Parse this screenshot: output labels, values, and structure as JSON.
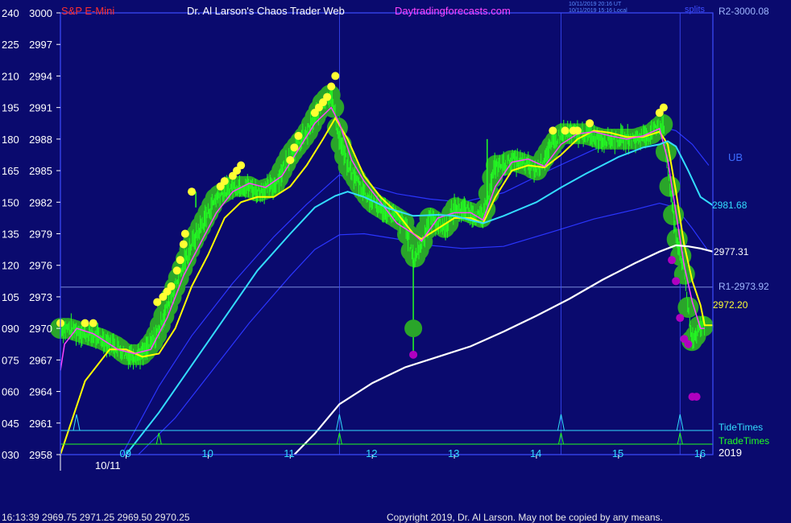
{
  "header": {
    "symbol": "S&P E-Mini",
    "title": "Dr. Al Larson's Chaos Trader Web",
    "site": "Daytradingforecasts.com",
    "ts_utc": "10/11/2019 20:16 UT",
    "ts_local": "10/11/2019 15:16 Local",
    "corner_label": "splits"
  },
  "colors": {
    "background": "#0a0a6e",
    "price_bars": "#22ff22",
    "halo": "#2aa52a",
    "yellow_line": "#ffff00",
    "magenta_line": "#ff44ff",
    "cyan_line": "#33ddff",
    "blue_band": "#2a35ff",
    "white_line": "#ffffff",
    "tide": "#33ddff",
    "trade": "#22ff22",
    "symbol": "#ff3030",
    "site": "#ff44ff"
  },
  "chart_data": {
    "type": "line",
    "x_ticks": [
      "09",
      "10",
      "11",
      "12",
      "13",
      "14",
      "15",
      "16"
    ],
    "x_tick_values": [
      9,
      10,
      11,
      12,
      13,
      14,
      15,
      16
    ],
    "date_label": "10/11",
    "year_label": "2019",
    "xlim": [
      8.2,
      16.15
    ],
    "y_ticks_price": [
      "3000",
      "2997",
      "2994",
      "2991",
      "2988",
      "2985",
      "2982",
      "2979",
      "2976",
      "2973",
      "2970",
      "2967",
      "2964",
      "2961",
      "2958"
    ],
    "y_ticks_angle": [
      "240",
      "225",
      "210",
      "195",
      "180",
      "165",
      "150",
      "135",
      "120",
      "105",
      "090",
      "075",
      "060",
      "045",
      "030"
    ],
    "ylim": [
      2958,
      3000
    ],
    "price_series": {
      "x": [
        8.2,
        8.3,
        8.5,
        8.7,
        8.9,
        9.0,
        9.2,
        9.35,
        9.5,
        9.6,
        9.7,
        9.8,
        10.0,
        10.1,
        10.3,
        10.5,
        10.6,
        10.8,
        10.9,
        11.0,
        11.2,
        11.4,
        11.5,
        11.6,
        11.7,
        11.9,
        12.0,
        12.2,
        12.4,
        12.5,
        12.6,
        12.7,
        12.9,
        13.0,
        13.2,
        13.35,
        13.5,
        13.6,
        13.7,
        13.9,
        14.0,
        14.2,
        14.3,
        14.4,
        14.6,
        14.8,
        15.0,
        15.2,
        15.4,
        15.55,
        15.6,
        15.7,
        15.8,
        15.85,
        15.9,
        16.0,
        16.05
      ],
      "y": [
        2970,
        2970,
        2969.5,
        2969,
        2968.2,
        2967.5,
        2967.5,
        2969,
        2972,
        2974,
        2976,
        2978,
        2981,
        2982.5,
        2983.5,
        2983.5,
        2983,
        2983.5,
        2985,
        2986.5,
        2988.5,
        2991.5,
        2992.3,
        2988,
        2985.5,
        2983,
        2982,
        2981,
        2980,
        2976.5,
        2978,
        2980.5,
        2979.5,
        2981.5,
        2981,
        2980.5,
        2985.5,
        2985.5,
        2986,
        2985.5,
        2985,
        2987.5,
        2988.5,
        2988.5,
        2988.5,
        2988,
        2988,
        2988,
        2988.5,
        2989.5,
        2985,
        2979,
        2975.5,
        2972,
        2968.5,
        2970.5,
        2970
      ]
    },
    "series": [
      {
        "x": [
          8.2,
          8.5,
          8.8,
          9.0,
          9.2,
          9.4,
          9.6,
          9.8,
          10.0,
          10.2,
          10.4,
          10.6,
          10.8,
          11.0,
          11.2,
          11.4,
          11.55,
          11.7,
          11.9,
          12.1,
          12.3,
          12.5,
          12.6,
          12.8,
          13.0,
          13.2,
          13.35,
          13.5,
          13.7,
          13.9,
          14.1,
          14.3,
          14.5,
          14.7,
          14.9,
          15.1,
          15.3,
          15.5,
          15.6,
          15.7,
          15.8,
          15.9,
          16.0,
          16.05,
          16.15
        ],
        "y": [
          2958,
          2965,
          2968,
          2968,
          2967.3,
          2967.6,
          2970,
          2974,
          2977,
          2980.5,
          2982,
          2982.5,
          2982.5,
          2983.5,
          2985.5,
          2988,
          2990,
          2988,
          2984.5,
          2982.5,
          2981,
          2979,
          2978.5,
          2979.5,
          2980.5,
          2980.5,
          2980,
          2982.5,
          2985,
          2985.5,
          2985.3,
          2986.5,
          2988,
          2988.8,
          2988.6,
          2988.2,
          2988.2,
          2988.7,
          2987.5,
          2983,
          2978,
          2974.5,
          2972.2,
          2970.3,
          2970.3
        ]
      },
      {
        "x": [
          8.2,
          8.25,
          8.4,
          8.6,
          8.9,
          9.1,
          9.3,
          9.5,
          9.7,
          9.9,
          10.1,
          10.3,
          10.5,
          10.7,
          10.9,
          11.1,
          11.3,
          11.5,
          11.6,
          11.75,
          11.9,
          12.1,
          12.3,
          12.5,
          12.6,
          12.8,
          13.0,
          13.2,
          13.35,
          13.5,
          13.7,
          13.9,
          14.1,
          14.3,
          14.5,
          14.7,
          14.9,
          15.1,
          15.3,
          15.5,
          15.6,
          15.7,
          15.8,
          15.9,
          16.0,
          16.05
        ],
        "y": [
          2966,
          2968.5,
          2970,
          2969.5,
          2968,
          2967.6,
          2968,
          2971,
          2975,
          2978,
          2981,
          2983,
          2983.8,
          2983.4,
          2984.5,
          2987,
          2989.5,
          2991,
          2989.5,
          2986,
          2984,
          2982,
          2980,
          2979,
          2978.3,
          2980.5,
          2981,
          2981,
          2980.3,
          2983.5,
          2985.8,
          2986.1,
          2985.4,
          2987.5,
          2988.5,
          2988.7,
          2988.3,
          2988,
          2988.3,
          2989,
          2986,
          2981,
          2976,
          2972.5,
          2970,
          2970
        ]
      },
      {
        "x": [
          9.0,
          9.4,
          9.8,
          10.2,
          10.6,
          11.0,
          11.3,
          11.55,
          11.7,
          11.9,
          12.2,
          12.5,
          12.8,
          13.0,
          13.35,
          13.6,
          14.0,
          14.3,
          14.6,
          15.0,
          15.3,
          15.5,
          15.6,
          15.7,
          15.85,
          16.0,
          16.15
        ],
        "y": [
          2958,
          2962,
          2966.5,
          2971,
          2975.5,
          2979,
          2981.5,
          2982.6,
          2983,
          2982.5,
          2981.4,
          2980.7,
          2980.8,
          2980.7,
          2980,
          2980.7,
          2982,
          2983.4,
          2984.7,
          2986.3,
          2987.2,
          2987.5,
          2987.8,
          2987.3,
          2985,
          2982.5,
          2981.7
        ]
      },
      {
        "x": [
          8.95,
          9.4,
          9.8,
          10.3,
          10.8,
          11.2,
          11.6,
          11.9,
          12.3,
          12.7,
          13.1,
          13.6,
          14.2,
          14.7,
          15.2,
          15.5,
          15.7,
          15.9,
          16.1
        ],
        "y": [
          2958,
          2964.5,
          2969.3,
          2974.3,
          2978.7,
          2981.8,
          2984.6,
          2983.7,
          2982.8,
          2982.3,
          2982,
          2982.9,
          2985.2,
          2987,
          2988.4,
          2989.2,
          2988.8,
          2987.5,
          2985.5
        ]
      },
      {
        "x": [
          9.15,
          9.6,
          10.0,
          10.5,
          11.0,
          11.3,
          11.6,
          11.9,
          12.3,
          12.7,
          13.1,
          13.6,
          14.2,
          14.7,
          15.2,
          15.5,
          15.7,
          15.9,
          16.1
        ],
        "y": [
          2958,
          2961.5,
          2965.5,
          2970.5,
          2975,
          2977.5,
          2978.9,
          2979,
          2978.5,
          2977.9,
          2977.6,
          2977.8,
          2979.2,
          2980.4,
          2981.3,
          2981.9,
          2981.5,
          2979.5,
          2977.3
        ]
      },
      {
        "x": [
          11.05,
          11.3,
          11.6,
          12.0,
          12.4,
          12.8,
          13.2,
          13.6,
          14.0,
          14.4,
          14.8,
          15.2,
          15.5,
          15.7,
          15.85,
          16.0,
          16.15
        ],
        "y": [
          2958,
          2960,
          2962.8,
          2964.8,
          2966.3,
          2967.3,
          2968.3,
          2969.7,
          2971.2,
          2972.8,
          2974.6,
          2976.2,
          2977.3,
          2977.9,
          2977.8,
          2977.6,
          2977.3
        ]
      }
    ],
    "yellow_dots": {
      "x": [
        8.2,
        8.5,
        8.6,
        9.38,
        9.45,
        9.5,
        9.55,
        9.62,
        9.66,
        9.7,
        9.72,
        9.8,
        10.15,
        10.2,
        10.3,
        10.35,
        10.4,
        11.0,
        11.05,
        11.1,
        11.3,
        11.35,
        11.4,
        11.45,
        11.5,
        11.55,
        14.2,
        14.35,
        14.45,
        14.5,
        14.65,
        15.5,
        15.55
      ],
      "y": [
        2970.5,
        2970.5,
        2970.5,
        2972.5,
        2973,
        2973.5,
        2974,
        2975.5,
        2976.5,
        2978,
        2979,
        2983,
        2983.5,
        2984,
        2984.5,
        2985,
        2985.5,
        2986,
        2987.2,
        2988.3,
        2990.5,
        2991,
        2991.5,
        2992,
        2993,
        2994,
        2988.8,
        2988.8,
        2988.8,
        2988.8,
        2989.5,
        2990.5,
        2991
      ]
    },
    "magenta_dots": {
      "x": [
        12.5,
        15.65,
        15.7,
        15.75,
        15.8,
        15.85,
        15.9,
        15.95
      ],
      "y": [
        2967.5,
        2976.5,
        2974.5,
        2971,
        2969,
        2968.5,
        2963.5,
        2963.5
      ]
    },
    "spikes": [
      {
        "x": 9.85,
        "y_from": 2981.5,
        "y_to": 2983
      },
      {
        "x": 12.5,
        "y_from": 2967.5,
        "y_to": 2976.5
      },
      {
        "x": 13.4,
        "y_from": 2981,
        "y_to": 2988
      }
    ],
    "h_lines": [
      {
        "y": 2973.92,
        "label": "R1-2973.92",
        "color": "#9fb6ff"
      }
    ],
    "v_lines": [
      8.2,
      11.6,
      14.3,
      15.75
    ],
    "tide_times": [
      8.2,
      11.6,
      14.3,
      15.75
    ],
    "trade_times": [
      9.4,
      11.6,
      14.3,
      15.75
    ],
    "tide_label": "TideTimes",
    "trade_label": "TradeTimes",
    "labels": {
      "r2": "R2-3000.08",
      "ub": "UB",
      "cyan": "2981.68",
      "white": "2977.31",
      "yellow": "2972.20"
    }
  },
  "footer": {
    "status": "16:13:39  2969.75 2971.25 2969.50 2970.25",
    "copyright": "Copyright 2019, Dr. Al Larson. May not be copied by any means."
  }
}
